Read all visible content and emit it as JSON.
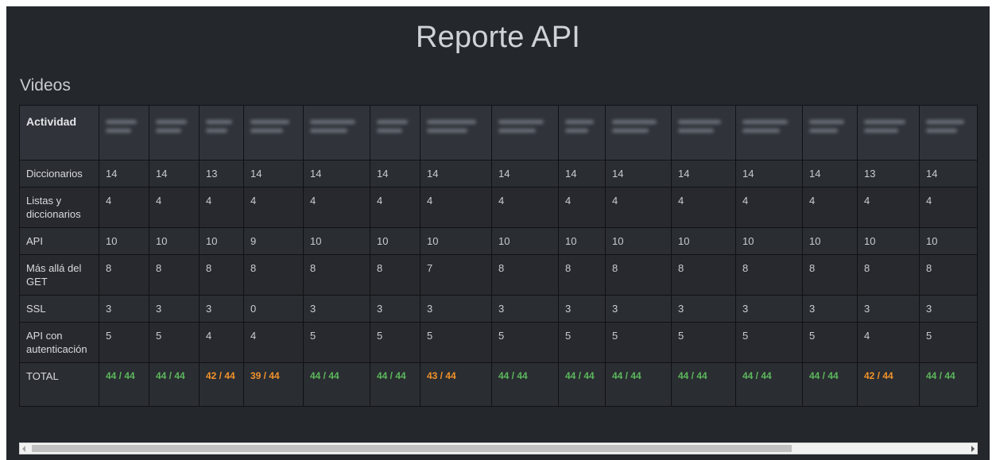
{
  "title": "Reporte API",
  "section": "Videos",
  "table": {
    "first_header": "Actividad",
    "student_count": 15,
    "rows": [
      {
        "label": "Diccionarios",
        "values": [
          "14",
          "14",
          "13",
          "14",
          "14",
          "14",
          "14",
          "14",
          "14",
          "14",
          "14",
          "14",
          "14",
          "13",
          "14"
        ]
      },
      {
        "label": "Listas y diccionarios",
        "values": [
          "4",
          "4",
          "4",
          "4",
          "4",
          "4",
          "4",
          "4",
          "4",
          "4",
          "4",
          "4",
          "4",
          "4",
          "4"
        ]
      },
      {
        "label": "API",
        "values": [
          "10",
          "10",
          "10",
          "9",
          "10",
          "10",
          "10",
          "10",
          "10",
          "10",
          "10",
          "10",
          "10",
          "10",
          "10"
        ]
      },
      {
        "label": "Más allá del GET",
        "values": [
          "8",
          "8",
          "8",
          "8",
          "8",
          "8",
          "7",
          "8",
          "8",
          "8",
          "8",
          "8",
          "8",
          "8",
          "8"
        ]
      },
      {
        "label": "SSL",
        "values": [
          "3",
          "3",
          "3",
          "0",
          "3",
          "3",
          "3",
          "3",
          "3",
          "3",
          "3",
          "3",
          "3",
          "3",
          "3"
        ]
      },
      {
        "label": "API con autenticación",
        "values": [
          "5",
          "5",
          "4",
          "4",
          "5",
          "5",
          "5",
          "5",
          "5",
          "5",
          "5",
          "5",
          "5",
          "4",
          "5"
        ]
      }
    ],
    "total": {
      "label": "TOTAL",
      "values": [
        {
          "text": "44 / 44",
          "status": "complete"
        },
        {
          "text": "44 / 44",
          "status": "complete"
        },
        {
          "text": "42 / 44",
          "status": "incomplete"
        },
        {
          "text": "39 / 44",
          "status": "incomplete"
        },
        {
          "text": "44 / 44",
          "status": "complete"
        },
        {
          "text": "44 / 44",
          "status": "complete"
        },
        {
          "text": "43 / 44",
          "status": "incomplete"
        },
        {
          "text": "44 / 44",
          "status": "complete"
        },
        {
          "text": "44 / 44",
          "status": "complete"
        },
        {
          "text": "44 / 44",
          "status": "complete"
        },
        {
          "text": "44 / 44",
          "status": "complete"
        },
        {
          "text": "44 / 44",
          "status": "complete"
        },
        {
          "text": "44 / 44",
          "status": "complete"
        },
        {
          "text": "42 / 44",
          "status": "incomplete"
        },
        {
          "text": "44 / 44",
          "status": "complete"
        }
      ]
    }
  },
  "colors": {
    "background": "#24272c",
    "complete": "#5cb85c",
    "incomplete": "#f0922b"
  },
  "scrollbar": {
    "horizontal_position": 0
  }
}
